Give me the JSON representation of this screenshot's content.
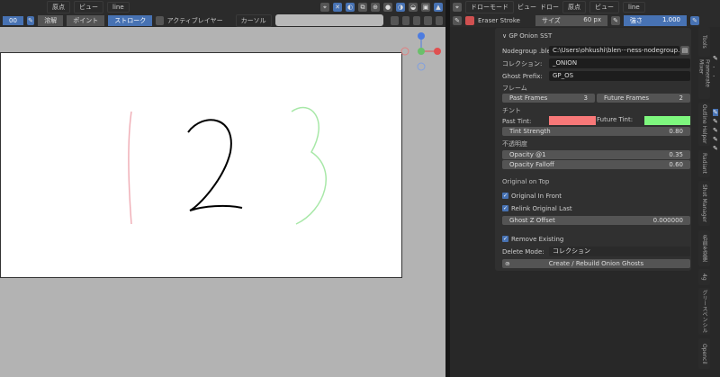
{
  "left_header": {
    "pivot": "原点",
    "view": "ビュー",
    "object": "line",
    "mode_num": "00",
    "modes": [
      "溶解",
      "ポイント",
      "ストローク"
    ],
    "active_mode": 2,
    "active_layer": "アクティブレイヤー",
    "cursor": "カーソル"
  },
  "right_header": {
    "mode": "ドローモード",
    "menu_view": "ビュー",
    "menu_draw": "ドロー",
    "pivot": "原点",
    "view": "ビュー",
    "object": "line",
    "brush": "Eraser Stroke",
    "size_label": "サイズ",
    "size_value": "60 px",
    "strength_label": "強さ",
    "strength_value": "1.000"
  },
  "panel": {
    "title": "GP Onion SST",
    "nodegroup_label": "Nodegroup .ble···",
    "nodegroup_value": "C:\\Users\\ohkushi\\blen···ness-nodegroup.blend",
    "collection_label": "コレクション:",
    "collection_value": "_ONION",
    "prefix_label": "Ghost Prefix:",
    "prefix_value": "GP_OS",
    "frames_section": "フレーム",
    "past_frames_label": "Past Frames",
    "past_frames": "3",
    "future_frames_label": "Future Frames",
    "future_frames": "2",
    "tint_section": "チント",
    "past_tint_label": "Past Tint:",
    "future_tint_label": "Future Tint:",
    "past_tint_color": "#f87878",
    "future_tint_color": "#7ef77e",
    "tint_strength_label": "Tint Strength",
    "tint_strength": "0.80",
    "opacity_section": "不透明度",
    "opacity1_label": "Opacity @1",
    "opacity1": "0.35",
    "falloff_label": "Opacity Falloff",
    "falloff": "0.60",
    "top_section": "Original on Top",
    "orig_front": "Original In Front",
    "relink": "Relink Original Last",
    "zoffset_label": "Ghost Z Offset",
    "zoffset": "0.000000",
    "remove_existing": "Remove Existing",
    "delete_mode_label": "Delete Mode:",
    "delete_mode": "コレクション",
    "create_button": "Create / Rebuild Onion Ghosts"
  },
  "tabs": [
    "Tools",
    "Framerate Mixer",
    "Outline Helper",
    "Radiant",
    "Shot Manager",
    "名前を変更",
    "4g",
    "グリースペンシル",
    "Opencil"
  ]
}
